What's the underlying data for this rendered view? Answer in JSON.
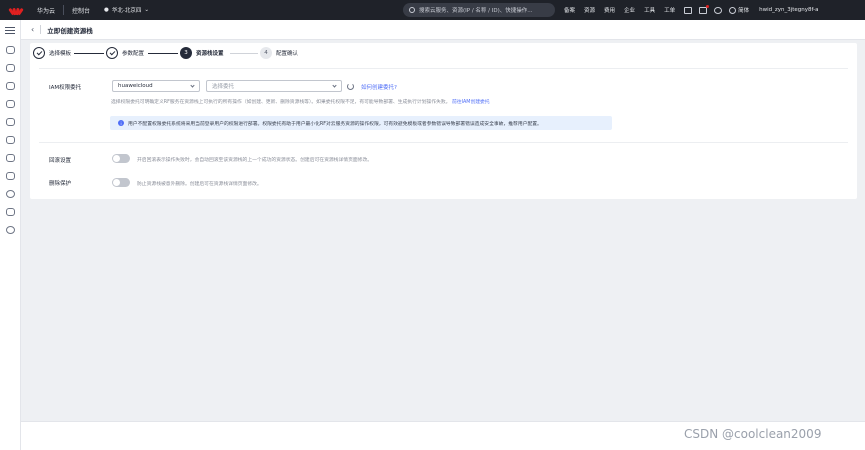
{
  "topbar": {
    "brand": "华为云",
    "console": "控制台",
    "region": "华北-北京四",
    "search_placeholder": "搜索云服务、资源(IP / 名称 / ID)、快捷操作...",
    "nav": [
      "备案",
      "资源",
      "费用",
      "企业",
      "工具",
      "工单"
    ],
    "lang": "简体",
    "user": "hwid_zyn_3jtegny8f-a"
  },
  "page": {
    "title": "立即创建资源栈"
  },
  "steps": [
    {
      "num": "1",
      "label": "选择模板",
      "state": "done"
    },
    {
      "num": "2",
      "label": "参数配置",
      "state": "done"
    },
    {
      "num": "3",
      "label": "资源栈设置",
      "state": "active"
    },
    {
      "num": "4",
      "label": "配置确认",
      "state": "todo"
    }
  ],
  "iam": {
    "label": "IAM权限委托",
    "provider_value": "huaweicloud",
    "agency_placeholder": "选择委托",
    "how_to_create": "如何创建委托?",
    "description": "选择权限委托可明确定义RF服务在资源栈上可执行的所有操作（如创建、更新、删除资源栈等）。如果委托权限不足，有可能导致部署、生成执行计划操作失败。",
    "go_create": "前往IAM创建委托",
    "notice": "用户不配置权限委托系统将采用当前登录用户的权限进行部署。权限委托有助于用户最小化RF对云服务资源的操作权限，可有效避免模板或者参数错误导致部署错误造成安全事故，推荐用户配置。"
  },
  "rollback": {
    "label": "回滚设置",
    "description": "开启回滚表示操作失败时，会自动回滚至该资源栈的上一个成功的资源状态。创建后可在资源栈详情页面修改。"
  },
  "deletion": {
    "label": "删除保护",
    "description": "防止资源栈被意外删除。创建后可在资源栈详情页面修改。"
  },
  "watermark": "CSDN @coolclean2009"
}
